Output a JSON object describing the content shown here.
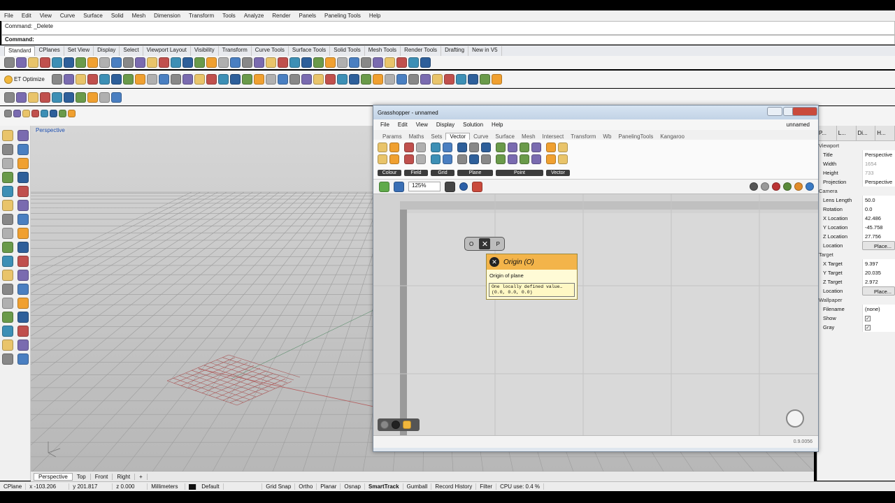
{
  "menubar": [
    "File",
    "Edit",
    "View",
    "Curve",
    "Surface",
    "Solid",
    "Mesh",
    "Dimension",
    "Transform",
    "Tools",
    "Analyze",
    "Render",
    "Panels",
    "Paneling Tools",
    "Help"
  ],
  "command": {
    "history": "Command: _Delete",
    "prompt": "Command:"
  },
  "toolbar_tabs": [
    "Standard",
    "CPlanes",
    "Set View",
    "Display",
    "Select",
    "Viewport Layout",
    "Visibility",
    "Transform",
    "Curve Tools",
    "Surface Tools",
    "Solid Tools",
    "Mesh Tools",
    "Render Tools",
    "Drafting",
    "New in V5"
  ],
  "optimize_label": "ET Optimize",
  "viewport": {
    "name": "Perspective",
    "tabs": [
      "Perspective",
      "Top",
      "Front",
      "Right"
    ],
    "add_tab": "+"
  },
  "statusbar": {
    "cplane": "CPlane",
    "x": "x -103.206",
    "y": "y 201.817",
    "z": "z 0.000",
    "units": "Millimeters",
    "layer": "Default",
    "toggles": [
      "Grid Snap",
      "Ortho",
      "Planar",
      "Osnap",
      "SmartTrack",
      "Gumball",
      "Record History",
      "Filter"
    ],
    "cpu": "CPU use: 0.4 %"
  },
  "right_panel": {
    "tabs": [
      "P...",
      "L...",
      "Di...",
      "H..."
    ],
    "viewport_section": "Viewport",
    "viewport_rows": [
      {
        "k": "Title",
        "v": "Perspective"
      },
      {
        "k": "Width",
        "v": "1654"
      },
      {
        "k": "Height",
        "v": "733"
      },
      {
        "k": "Projection",
        "v": "Perspective"
      }
    ],
    "camera_section": "Camera",
    "camera_rows": [
      {
        "k": "Lens Length",
        "v": "50.0"
      },
      {
        "k": "Rotation",
        "v": "0.0"
      },
      {
        "k": "X Location",
        "v": "42.486"
      },
      {
        "k": "Y Location",
        "v": "-45.758"
      },
      {
        "k": "Z Location",
        "v": "27.756"
      }
    ],
    "location_label": "Location",
    "place_button": "Place...",
    "target_section": "Target",
    "target_rows": [
      {
        "k": "X Target",
        "v": "9.397"
      },
      {
        "k": "Y Target",
        "v": "20.035"
      },
      {
        "k": "Z Target",
        "v": "2.972"
      }
    ],
    "wallpaper_section": "Wallpaper",
    "filename_label": "Filename",
    "filename_value": "(none)",
    "show_label": "Show",
    "gray_label": "Gray",
    "check": "✓"
  },
  "grasshopper": {
    "title": "Grasshopper - unnamed",
    "doc_name": "unnamed",
    "menu": [
      "File",
      "Edit",
      "View",
      "Display",
      "Solution",
      "Help"
    ],
    "tabs": [
      "Params",
      "Maths",
      "Sets",
      "Vector",
      "Curve",
      "Surface",
      "Mesh",
      "Intersect",
      "Transform",
      "Wb",
      "PanelingTools",
      "Kangaroo"
    ],
    "active_tab": "Vector",
    "ribbon_groups": [
      "Colour",
      "Field",
      "Grid",
      "Plane",
      "Point",
      "Vector"
    ],
    "zoom": "125%",
    "version": "0.9.0056",
    "component": {
      "left_param": "O",
      "right_param": "P"
    },
    "tooltip": {
      "title": "Origin (O)",
      "description": "Origin of plane",
      "value_line1": "One locally defined value…",
      "value_line2": "(0.0, 0.0, 0.0)"
    }
  },
  "colors": {
    "accent_orange": "#f3b44a",
    "viewport_label": "#1d4fb0"
  }
}
